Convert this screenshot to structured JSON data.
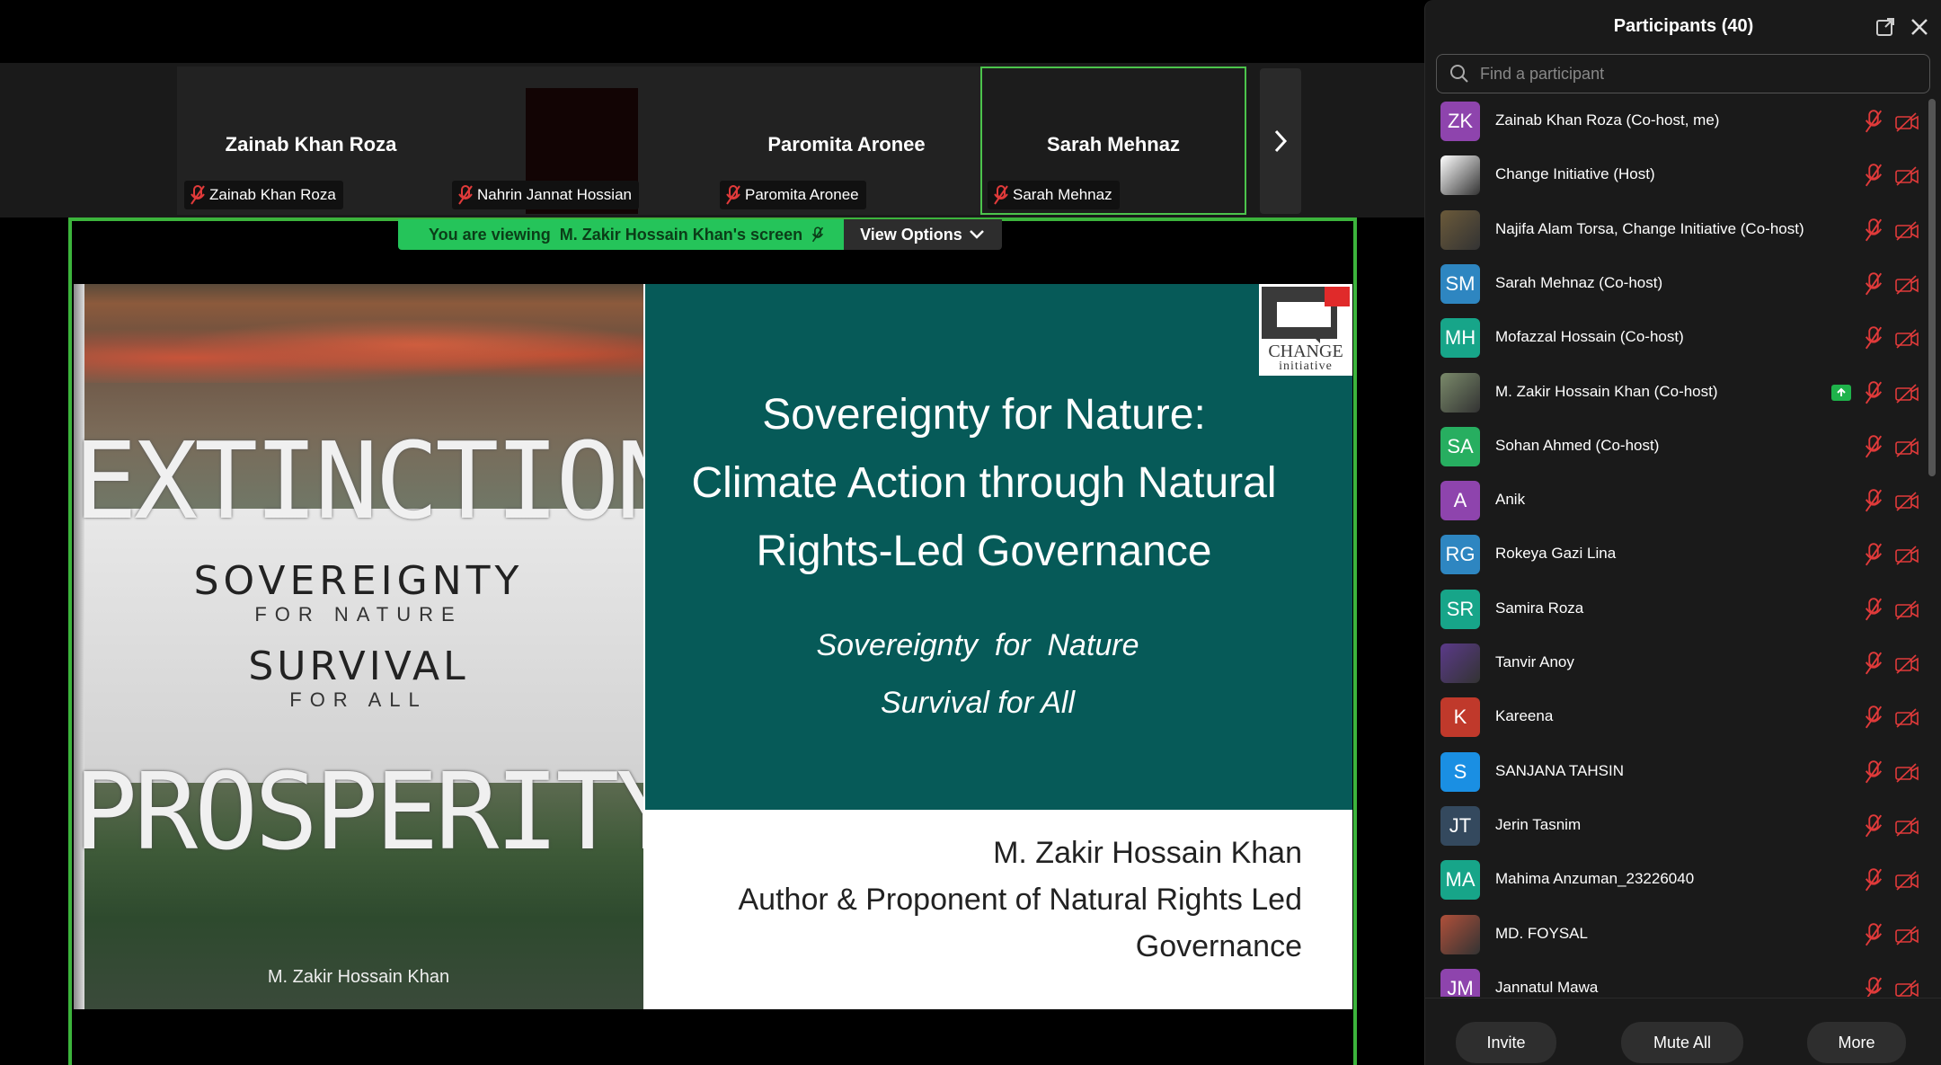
{
  "strip": {
    "tiles": [
      {
        "name": "Zainab Khan Roza",
        "tag": "Zainab Khan Roza"
      },
      {
        "name": "",
        "tag": "Nahrin Jannat Hossian"
      },
      {
        "name": "Paromita Aronee",
        "tag": "Paromita Aronee"
      },
      {
        "name": "Sarah Mehnaz",
        "tag": "Sarah Mehnaz"
      }
    ]
  },
  "share": {
    "viewing_prefix": "You are viewing",
    "viewing_name": "M. Zakir Hossain Khan's screen",
    "view_options": "View Options"
  },
  "slide": {
    "book": {
      "word_top": "EXTINCTION",
      "sovereignty": "SOVEREIGNTY",
      "for_nature": "FOR NATURE",
      "survival": "SURVIVAL",
      "for_all": "FOR ALL",
      "word_bottom": "PROSPERITY",
      "author": "M. Zakir Hossain Khan"
    },
    "title_lines": [
      "Sovereignty for Nature:",
      "Climate Action through Natural",
      "Rights-Led Governance"
    ],
    "subtitle_lines": [
      "Sovereignty  for  Nature",
      "Survival for All"
    ],
    "logo_text": "CHANGE",
    "logo_sub": "initiative",
    "presenter_lines": [
      "M. Zakir Hossain Khan",
      "Author & Proponent of Natural Rights Led",
      "Governance"
    ]
  },
  "panel": {
    "title": "Participants (40)",
    "search_placeholder": "Find a participant",
    "participants": [
      {
        "initials": "ZK",
        "color": "#8e44ad",
        "name": "Zainab Khan Roza (Co-host, me)"
      },
      {
        "initials": "",
        "color": "#ffffff",
        "name": "Change Initiative (Host)"
      },
      {
        "initials": "",
        "color": "#6b5a3a",
        "name": "Najifa Alam Torsa, Change Initiative (Co-host)"
      },
      {
        "initials": "SM",
        "color": "#2e86c1",
        "name": "Sarah Mehnaz (Co-host)"
      },
      {
        "initials": "MH",
        "color": "#17a589",
        "name": "Mofazzal Hossain (Co-host)"
      },
      {
        "initials": "",
        "color": "#7a8a6a",
        "name": "M. Zakir Hossain Khan (Co-host)",
        "sharing": true
      },
      {
        "initials": "SA",
        "color": "#27ae60",
        "name": "Sohan Ahmed (Co-host)"
      },
      {
        "initials": "A",
        "color": "#8e44ad",
        "name": "Anik"
      },
      {
        "initials": "RG",
        "color": "#2e86c1",
        "name": "Rokeya Gazi Lina"
      },
      {
        "initials": "SR",
        "color": "#17a589",
        "name": "Samira Roza"
      },
      {
        "initials": "",
        "color": "#5b3a8a",
        "name": "Tanvir Anoy"
      },
      {
        "initials": "K",
        "color": "#c0392b",
        "name": "Kareena"
      },
      {
        "initials": "S",
        "color": "#1a8fe3",
        "name": "SANJANA TAHSIN"
      },
      {
        "initials": "JT",
        "color": "#34495e",
        "name": "Jerin Tasnim"
      },
      {
        "initials": "MA",
        "color": "#17a589",
        "name": "Mahima Anzuman_23226040"
      },
      {
        "initials": "",
        "color": "#b0503a",
        "name": "MD. FOYSAL"
      },
      {
        "initials": "JM",
        "color": "#8e44ad",
        "name": "Jannatul Mawa"
      }
    ],
    "footer": {
      "invite": "Invite",
      "mute_all": "Mute All",
      "more": "More"
    }
  },
  "colors": {
    "accent_green": "#3cb43c",
    "teal": "#065a58",
    "muted_red": "#e03a3a"
  }
}
